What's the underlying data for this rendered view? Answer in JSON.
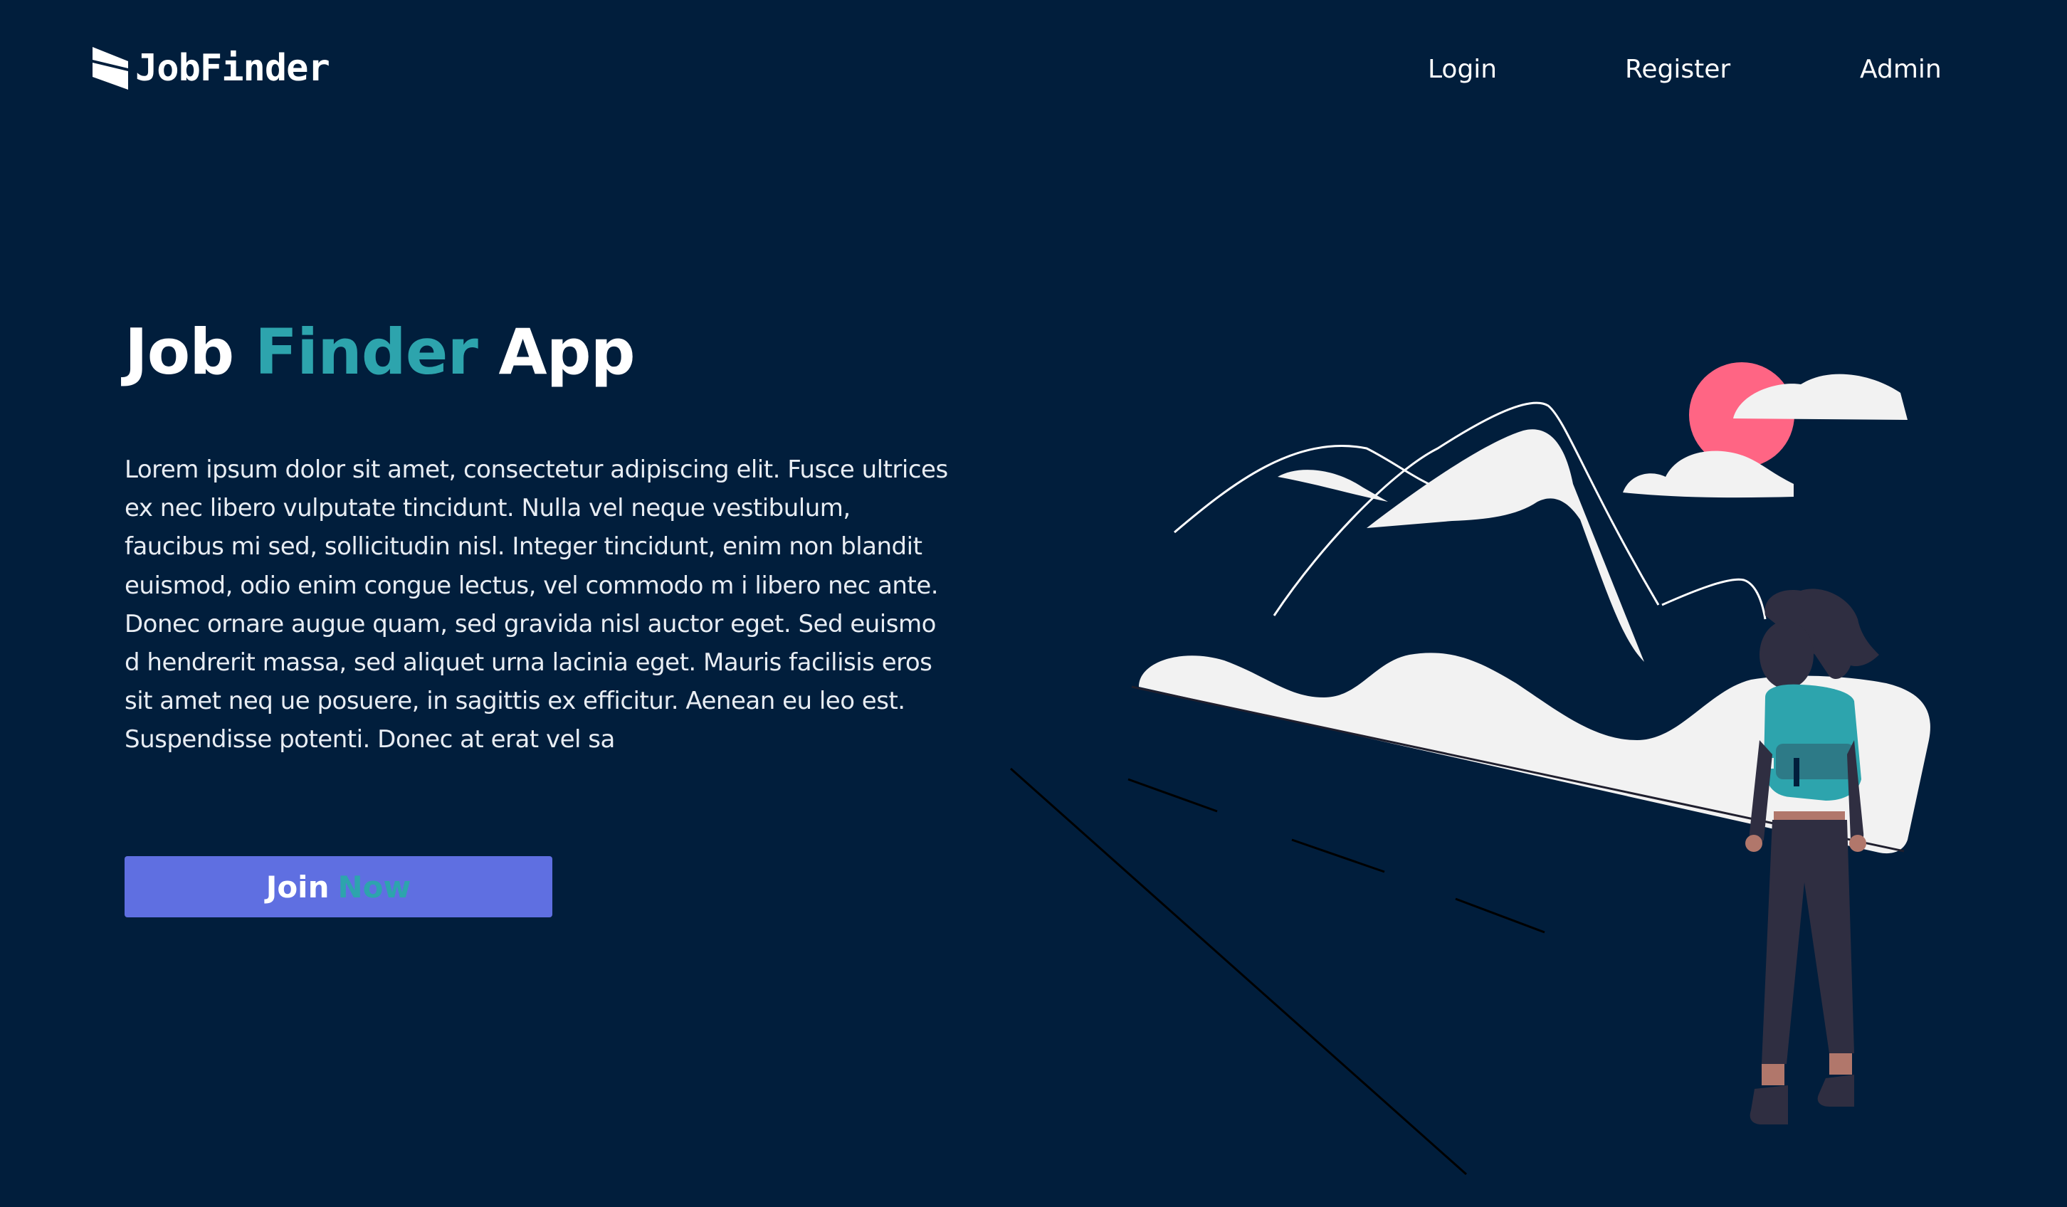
{
  "navbar": {
    "logo_text": "JobFinder",
    "logo_icon": "flag-logo-icon",
    "links": {
      "login": "Login",
      "register": "Register",
      "admin": "Admin"
    }
  },
  "hero": {
    "title_part1": "Job",
    "title_accent": "Finder",
    "title_part2": "App",
    "description": "Lorem ipsum dolor sit amet, consectetur adipiscing elit. Fusce ultrices ex nec libero vulputate tincidunt. Nulla vel neque vestibulum, faucibus mi sed, sollicitudin nisl. Integer tincidunt, enim non blandit euismod, odio enim congue lectus, vel commodo m i libero nec ante. Donec ornare augue quam, sed gravida nisl auctor eget. Sed euismo d hendrerit massa, sed aliquet urna lacinia eget. Mauris facilisis eros sit amet neq ue posuere, in sagittis ex efficitur. Aenean eu leo est. Suspendisse potenti. Donec at erat vel sa",
    "button_label_part1": "Join",
    "button_label_part2": "Now"
  },
  "illustration": {
    "subject": "traveler-mountains-illustration"
  },
  "colors": {
    "background": "#011E3C",
    "accent": "#2DA4AD",
    "button": "#5F6FE1",
    "sun": "#FF6584",
    "text": "#FFFFFF"
  }
}
